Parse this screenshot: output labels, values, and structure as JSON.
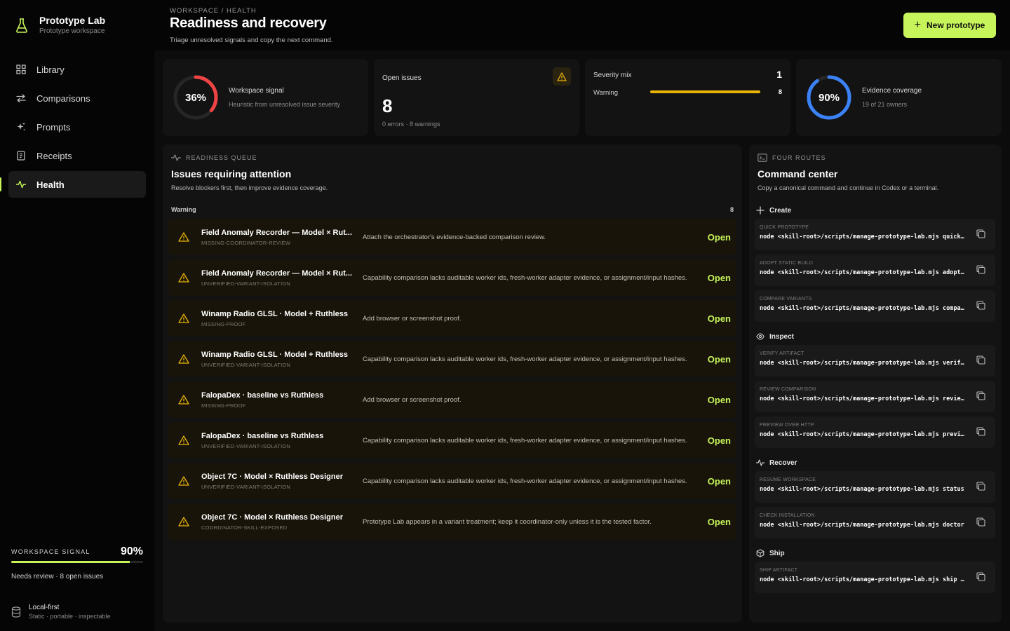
{
  "brand": {
    "name": "Prototype Lab",
    "subtitle": "Prototype workspace"
  },
  "nav": [
    {
      "label": "Library",
      "icon": "grid-icon"
    },
    {
      "label": "Comparisons",
      "icon": "arrows-icon"
    },
    {
      "label": "Prompts",
      "icon": "sparkle-icon"
    },
    {
      "label": "Receipts",
      "icon": "receipt-icon"
    },
    {
      "label": "Health",
      "icon": "pulse-icon",
      "active": true
    }
  ],
  "sidebar_signal": {
    "label": "Workspace signal",
    "value": "90%",
    "fill_fraction": 0.9,
    "note": "Needs review · 8 open issues"
  },
  "local": {
    "title": "Local-first",
    "subtitle": "Static · portable · inspectable"
  },
  "header": {
    "breadcrumb": "Workspace / Health",
    "title": "Readiness and recovery",
    "subtitle": "Triage unresolved signals and copy the next command.",
    "new_button": "New prototype"
  },
  "stats": {
    "signal": {
      "value": "36%",
      "fraction": 0.36,
      "title": "Workspace signal",
      "subtitle": "Heuristic from unresolved issue severity",
      "color": "#ef4444"
    },
    "open_issues": {
      "title": "Open issues",
      "value": "8",
      "subtitle": "0 errors · 8 warnings"
    },
    "severity": {
      "title": "Severity mix",
      "total": "1",
      "rows": [
        {
          "label": "Warning",
          "value": "8",
          "fraction": 1.0,
          "color": "#eab308"
        }
      ]
    },
    "coverage": {
      "value": "90%",
      "fraction": 0.9,
      "title": "Evidence coverage",
      "subtitle": "19 of 21 owners",
      "color": "#3b82f6"
    }
  },
  "queue": {
    "label": "Readiness queue",
    "title": "Issues requiring attention",
    "subtitle": "Resolve blockers first, then improve evidence coverage.",
    "group": "Warning",
    "group_count": "8",
    "action_label": "Open",
    "items": [
      {
        "name": "Field Anomaly Recorder — Model × Rut...",
        "code": "MISSING-COORDINATOR-REVIEW",
        "desc": "Attach the orchestrator's evidence-backed comparison review."
      },
      {
        "name": "Field Anomaly Recorder — Model × Rut...",
        "code": "UNVERIFIED-VARIANT-ISOLATION",
        "desc": "Capability comparison lacks auditable worker ids, fresh-worker adapter evidence, or assignment/input hashes."
      },
      {
        "name": "Winamp Radio GLSL · Model + Ruthless",
        "code": "MISSING-PROOF",
        "desc": "Add browser or screenshot proof."
      },
      {
        "name": "Winamp Radio GLSL · Model + Ruthless",
        "code": "UNVERIFIED-VARIANT-ISOLATION",
        "desc": "Capability comparison lacks auditable worker ids, fresh-worker adapter evidence, or assignment/input hashes."
      },
      {
        "name": "FalopaDex · baseline vs Ruthless",
        "code": "MISSING-PROOF",
        "desc": "Add browser or screenshot proof."
      },
      {
        "name": "FalopaDex · baseline vs Ruthless",
        "code": "UNVERIFIED-VARIANT-ISOLATION",
        "desc": "Capability comparison lacks auditable worker ids, fresh-worker adapter evidence, or assignment/input hashes."
      },
      {
        "name": "Object 7C · Model × Ruthless Designer",
        "code": "UNVERIFIED-VARIANT-ISOLATION",
        "desc": "Capability comparison lacks auditable worker ids, fresh-worker adapter evidence, or assignment/input hashes."
      },
      {
        "name": "Object 7C · Model × Ruthless Designer",
        "code": "COORDINATOR-SKILL-EXPOSED",
        "desc": "Prototype Lab appears in a variant treatment; keep it coordinator-only unless it is the tested factor."
      }
    ]
  },
  "command_center": {
    "label": "Four routes",
    "title": "Command center",
    "subtitle": "Copy a canonical command and continue in Codex or a terminal.",
    "routes": [
      {
        "name": "Create",
        "icon": "plus-icon",
        "commands": [
          {
            "label": "Quick prototype",
            "command": "node <skill-root>/scripts/manage-prototype-lab.mjs quick --"
          },
          {
            "label": "Adopt static build",
            "command": "node <skill-root>/scripts/manage-prototype-lab.mjs adopt --"
          },
          {
            "label": "Compare variants",
            "command": "node <skill-root>/scripts/manage-prototype-lab.mjs compare-"
          }
        ]
      },
      {
        "name": "Inspect",
        "icon": "eye-icon",
        "commands": [
          {
            "label": "Verify artifact",
            "command": "node <skill-root>/scripts/manage-prototype-lab.mjs verify --"
          },
          {
            "label": "Review comparison",
            "command": "node <skill-root>/scripts/manage-prototype-lab.mjs review --"
          },
          {
            "label": "Preview over HTTP",
            "command": "node <skill-root>/scripts/manage-prototype-lab.mjs preview--"
          }
        ]
      },
      {
        "name": "Recover",
        "icon": "pulse-icon",
        "commands": [
          {
            "label": "Resume workspace",
            "command": "node <skill-root>/scripts/manage-prototype-lab.mjs status"
          },
          {
            "label": "Check installation",
            "command": "node <skill-root>/scripts/manage-prototype-lab.mjs doctor"
          }
        ]
      },
      {
        "name": "Ship",
        "icon": "box-icon",
        "commands": [
          {
            "label": "Ship artifact",
            "command": "node <skill-root>/scripts/manage-prototype-lab.mjs ship --"
          }
        ]
      }
    ]
  },
  "colors": {
    "accent": "#c7f45a",
    "warning": "#eab308",
    "danger": "#ef4444",
    "info": "#3b82f6"
  }
}
